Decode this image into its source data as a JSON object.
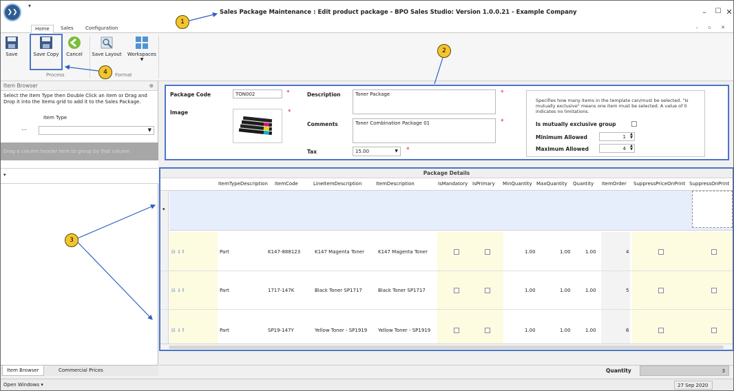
{
  "title": "Sales Package Maintenance : Edit product package - BPO Sales Studio: Version 1.0.0.21 - Example Company",
  "ribbon_tabs": [
    "Home",
    "Sales",
    "Configuration"
  ],
  "ribbon": {
    "save": "Save",
    "save_copy": "Save Copy",
    "cancel": "Cancel",
    "save_layout": "Save Layout",
    "workspaces": "Workspaces",
    "group_process": "Process",
    "group_format": "Format"
  },
  "left": {
    "header": "Item Browser",
    "help": "Select the Item Type then Double Click an item or Drag and Drop it into the items grid to add it to the Sales Package.",
    "item_type_label": "Item Type",
    "group_hint": "Drag a column header here to group by that column",
    "tabs": [
      "Item Browser",
      "Commercial Prices"
    ]
  },
  "form": {
    "package_code_label": "Package Code",
    "package_code": "TON002",
    "image_label": "Image",
    "description_label": "Description",
    "description": "Toner Package",
    "comments_label": "Comments",
    "comments": "Toner Combination Package 01",
    "tax_label": "Tax",
    "tax": "15.00",
    "info": "Specifies how many items in the template can/must be selected. \"Is mutually exclusive\" means one item must be selected. A value of 0 indicates no limitations.",
    "mutex_label": "Is mutually exclusive group",
    "min_label": "Minimum Allowed",
    "min_value": "1",
    "max_label": "Maximum Allowed",
    "max_value": "4"
  },
  "grid": {
    "title": "Package Details",
    "columns": [
      "ItemTypeDescription",
      "ItemCode",
      "LineItemDescription",
      "ItemDescription",
      "IsMandatory",
      "IsPrimary",
      "MinQuantity",
      "MaxQuantity",
      "Quantity",
      "ItemOrder",
      "SuppressPriceOnPrint",
      "SuppressOnPrint"
    ],
    "rows": [
      {
        "type": "Part",
        "code": "K147-888123",
        "line": "K147 Magenta Toner",
        "desc": "K147 Magenta Toner",
        "min": "1.00",
        "max": "1.00",
        "qty": "1.00",
        "order": "4"
      },
      {
        "type": "Part",
        "code": "1717-147K",
        "line": "Black Toner SP1717",
        "desc": "Black Toner SP1717",
        "min": "1.00",
        "max": "1.00",
        "qty": "1.00",
        "order": "5"
      },
      {
        "type": "Part",
        "code": "SP19-147Y",
        "line": "Yellow Toner - SP1919",
        "desc": "Yellow Toner - SP1919",
        "min": "1.00",
        "max": "1.00",
        "qty": "1.00",
        "order": "6"
      }
    ]
  },
  "footer": {
    "quantity_label": "Quantity",
    "quantity_value": "3",
    "open_windows": "Open Windows ▾",
    "date": "27 Sep 2020"
  },
  "callouts": [
    "1",
    "2",
    "3",
    "4"
  ],
  "colors": {
    "accent": "#4a74c9",
    "badge": "#f4c430",
    "yellow_col": "#fdfbe0"
  }
}
